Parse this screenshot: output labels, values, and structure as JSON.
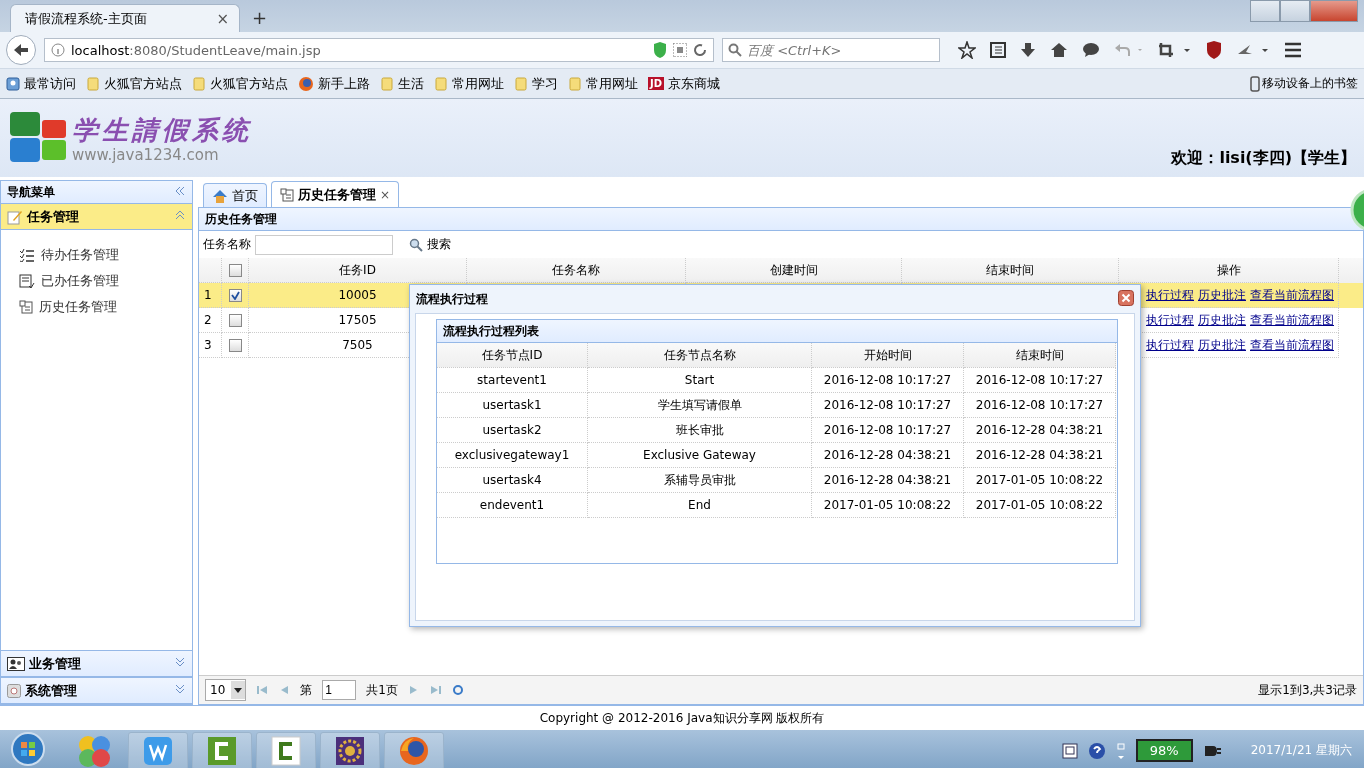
{
  "browser": {
    "tab_title": "请假流程系统-主页面",
    "tab_close": "×",
    "new_tab": "+",
    "url_host": "localhost",
    "url_path": ":8080/StudentLeave/main.jsp",
    "search_placeholder": "百度 <Ctrl+K>",
    "bookmarks": [
      {
        "label": "最常访问",
        "kind": "most"
      },
      {
        "label": "火狐官方站点",
        "kind": "folder"
      },
      {
        "label": "火狐官方站点",
        "kind": "folder"
      },
      {
        "label": "新手上路",
        "kind": "firefox"
      },
      {
        "label": "生活",
        "kind": "folder"
      },
      {
        "label": "常用网址",
        "kind": "folder"
      },
      {
        "label": "学习",
        "kind": "folder"
      },
      {
        "label": "常用网址",
        "kind": "folder"
      },
      {
        "label": "京东商城",
        "kind": "jd",
        "badge": "JD"
      }
    ],
    "mobile_bookmarks": "移动设备上的书签"
  },
  "header": {
    "site_title": "学生請假系统",
    "site_url": "www.java1234.com",
    "welcome": "欢迎：lisi(李四)【学生】"
  },
  "nav": {
    "title": "导航菜单",
    "sections": [
      {
        "title": "任务管理",
        "kind": "task",
        "expanded": true,
        "items": [
          {
            "label": "待办任务管理",
            "kind": "todo"
          },
          {
            "label": "已办任务管理",
            "kind": "done"
          },
          {
            "label": "历史任务管理",
            "kind": "history"
          }
        ]
      },
      {
        "title": "业务管理",
        "kind": "business",
        "expanded": false
      },
      {
        "title": "系统管理",
        "kind": "system",
        "expanded": false
      }
    ]
  },
  "tabs": [
    {
      "label": "首页",
      "kind": "home",
      "selected": false
    },
    {
      "label": "历史任务管理",
      "kind": "history",
      "selected": true,
      "close": "×"
    }
  ],
  "panel": {
    "title": "历史任务管理",
    "select_all_checked": false,
    "search_label": "任务名称",
    "search_button": "搜索",
    "columns": [
      "任务ID",
      "任务名称",
      "创建时间",
      "结束时间",
      "操作"
    ],
    "rows": [
      {
        "num": "1",
        "checked": true,
        "selected": true,
        "id": "10005",
        "actions": [
          "执行过程",
          "历史批注",
          "查看当前流程图"
        ]
      },
      {
        "num": "2",
        "checked": false,
        "selected": false,
        "id": "17505",
        "actions": [
          "执行过程",
          "历史批注",
          "查看当前流程图"
        ]
      },
      {
        "num": "3",
        "checked": false,
        "selected": false,
        "id": "7505",
        "actions": [
          "执行过程",
          "历史批注",
          "查看当前流程图"
        ]
      }
    ],
    "pager": {
      "page_size": "10",
      "page_prefix": "第",
      "page": "1",
      "page_total": "共1页",
      "summary": "显示1到3,共3记录"
    }
  },
  "dialog": {
    "title": "流程执行过程",
    "list_title": "流程执行过程列表",
    "columns": [
      "任务节点ID",
      "任务节点名称",
      "开始时间",
      "结束时间"
    ],
    "rows": [
      [
        "startevent1",
        "Start",
        "2016-12-08 10:17:27",
        "2016-12-08 10:17:27"
      ],
      [
        "usertask1",
        "学生填写请假单",
        "2016-12-08 10:17:27",
        "2016-12-08 10:17:27"
      ],
      [
        "usertask2",
        "班长审批",
        "2016-12-08 10:17:27",
        "2016-12-28 04:38:21"
      ],
      [
        "exclusivegateway1",
        "Exclusive Gateway",
        "2016-12-28 04:38:21",
        "2016-12-28 04:38:21"
      ],
      [
        "usertask4",
        "系辅导员审批",
        "2016-12-28 04:38:21",
        "2017-01-05 10:08:22"
      ],
      [
        "endevent1",
        "End",
        "2017-01-05 10:08:22",
        "2017-01-05 10:08:22"
      ]
    ]
  },
  "footer": "Copyright @ 2012-2016 Java知识分享网 版权所有",
  "taskbar": {
    "apps": [
      {
        "kind": "balls"
      },
      {
        "kind": "wps"
      },
      {
        "kind": "camtasia"
      },
      {
        "kind": "camtasia-light"
      },
      {
        "kind": "gear"
      },
      {
        "kind": "firefox"
      }
    ],
    "battery": "98%",
    "date": "2017/1/21 星期六"
  }
}
